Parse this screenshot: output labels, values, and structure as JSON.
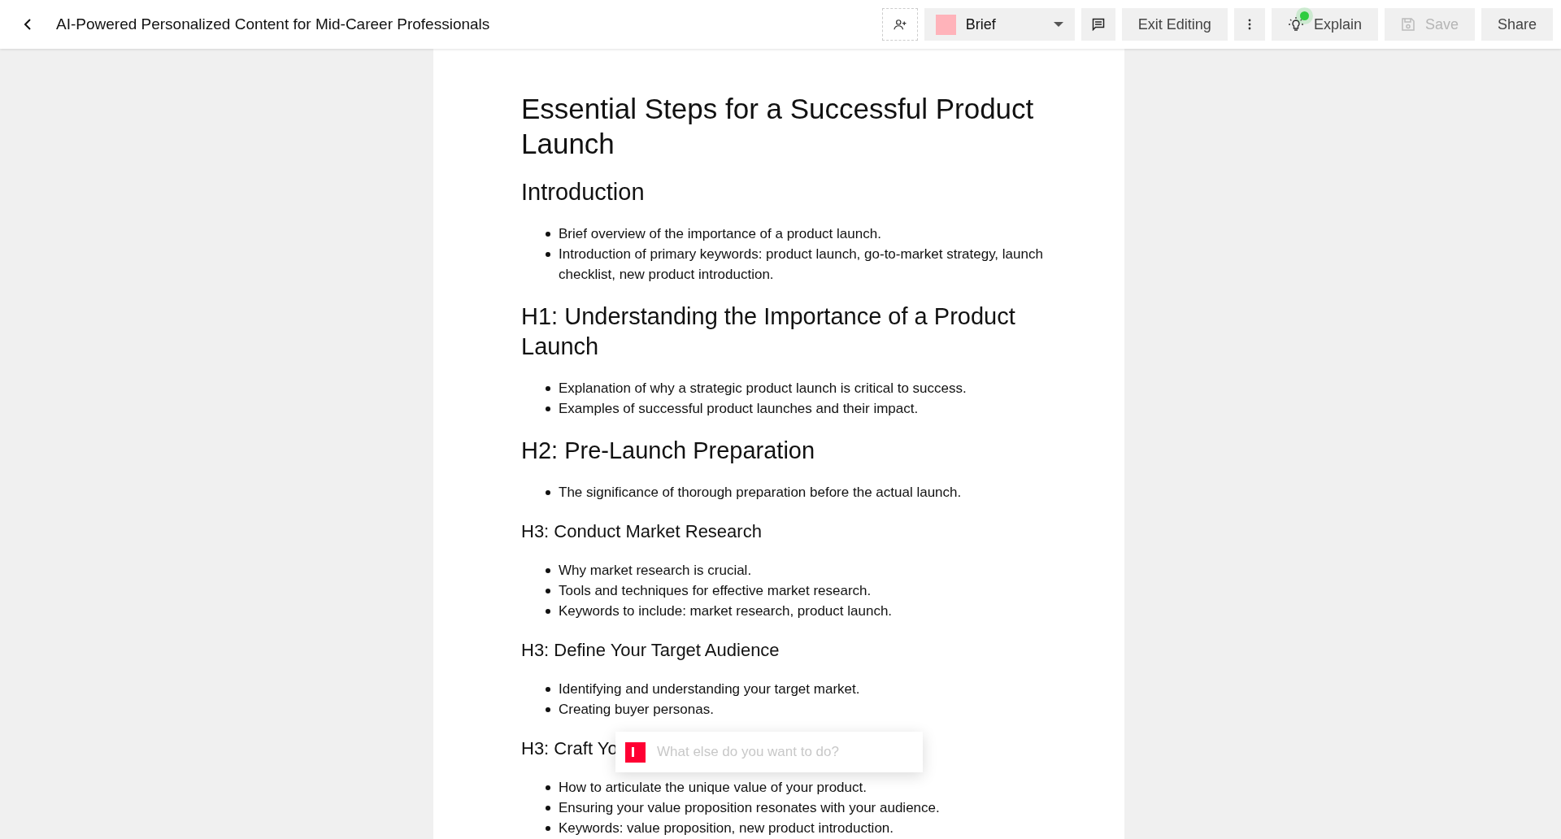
{
  "header": {
    "title": "AI-Powered Personalized Content for Mid-Career Professionals"
  },
  "toolbar": {
    "style_dropdown": {
      "label": "Brief",
      "color": "#ffb3ba"
    },
    "buttons": [
      {
        "kind": "comment"
      },
      {
        "kind": "text",
        "label": "Exit Editing",
        "disabled": false
      },
      {
        "kind": "more"
      },
      {
        "kind": "explain",
        "label": "Explain",
        "disabled": false,
        "notification": true
      },
      {
        "kind": "save",
        "label": "Save",
        "disabled": true
      },
      {
        "kind": "text",
        "label": "Share",
        "disabled": false
      }
    ]
  },
  "document": {
    "blocks": [
      {
        "kind": "title",
        "text": "Essential Steps for a Successful Product Launch"
      },
      {
        "kind": "h2",
        "text": "Introduction"
      },
      {
        "kind": "list",
        "items": [
          "Brief overview of the importance of a product launch.",
          "Introduction of primary keywords: product launch, go-to-market strategy, launch checklist, new product introduction."
        ]
      },
      {
        "kind": "h2",
        "text": "H1: Understanding the Importance of a Product Launch"
      },
      {
        "kind": "list",
        "items": [
          "Explanation of why a strategic product launch is critical to success.",
          "Examples of successful product launches and their impact."
        ]
      },
      {
        "kind": "h2",
        "text": "H2: Pre-Launch Preparation"
      },
      {
        "kind": "list",
        "items": [
          "The significance of thorough preparation before the actual launch."
        ]
      },
      {
        "kind": "h3",
        "text": "H3: Conduct Market Research"
      },
      {
        "kind": "list",
        "items": [
          "Why market research is crucial.",
          "Tools and techniques for effective market research.",
          "Keywords to include: market research, product launch."
        ]
      },
      {
        "kind": "h3",
        "text": "H3: Define Your Target Audience"
      },
      {
        "kind": "list",
        "items": [
          "Identifying and understanding your target market.",
          "Creating buyer personas."
        ]
      },
      {
        "kind": "h3",
        "text": "H3: Craft Yo"
      },
      {
        "kind": "list",
        "items": [
          "How to articulate the unique value of your product.",
          "Ensuring your value proposition resonates with your audience.",
          "Keywords: value proposition, new product introduction."
        ]
      }
    ]
  },
  "prompt": {
    "placeholder": "What else do you want to do?"
  }
}
